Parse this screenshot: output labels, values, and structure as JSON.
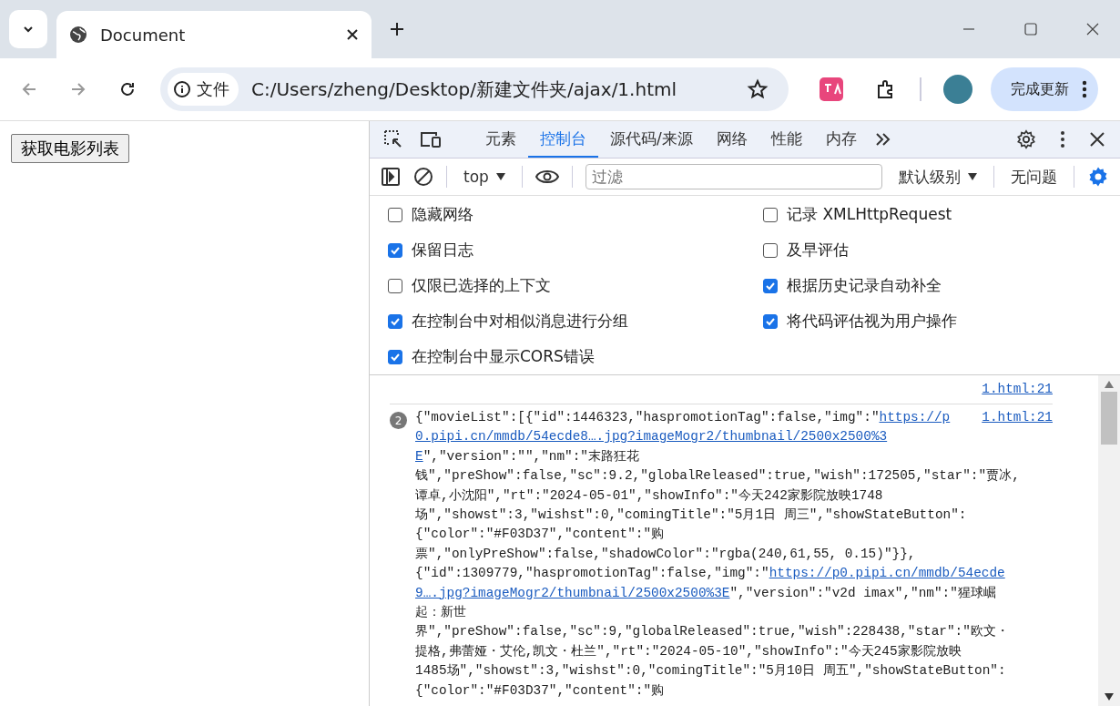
{
  "browser": {
    "tab_title": "Document",
    "address": {
      "badge": "文件",
      "url": "C:/Users/zheng/Desktop/新建文件夹/ajax/1.html"
    },
    "update_button": "完成更新"
  },
  "page": {
    "button": "获取电影列表"
  },
  "devtools": {
    "tabs": [
      {
        "label": "元素",
        "selected": false
      },
      {
        "label": "控制台",
        "selected": true
      },
      {
        "label": "源代码/来源",
        "selected": false
      },
      {
        "label": "网络",
        "selected": false
      },
      {
        "label": "性能",
        "selected": false
      },
      {
        "label": "内存",
        "selected": false
      }
    ],
    "toolbar": {
      "context": "top",
      "filter_placeholder": "过滤",
      "levels": "默认级别",
      "issues": "无问题"
    },
    "settings": [
      {
        "label": "隐藏网络",
        "checked": false
      },
      {
        "label": "记录 XMLHttpRequest",
        "checked": false
      },
      {
        "label": "保留日志",
        "checked": true
      },
      {
        "label": "及早评估",
        "checked": false
      },
      {
        "label": "仅限已选择的上下文",
        "checked": false
      },
      {
        "label": "根据历史记录自动补全",
        "checked": true
      },
      {
        "label": "在控制台中对相似消息进行分组",
        "checked": true
      },
      {
        "label": "将代码评估视为用户操作",
        "checked": true
      },
      {
        "label": "在控制台中显示CORS错误",
        "checked": true
      }
    ],
    "messages": [
      {
        "source": "1.html:21"
      },
      {
        "count": "2",
        "source": "1.html:21",
        "lines": [
          [
            {
              "kind": "text",
              "text": "{\"movieList\":[{\"id\":1446323,\"haspromotionTag\":false,\"img\":\""
            },
            {
              "kind": "link",
              "text": "https://p"
            }
          ],
          [
            {
              "kind": "link",
              "text": "0.pipi.cn/mmdb/54ecde8….jpg?imageMogr2/thumbnail/2500x2500%3"
            }
          ],
          [
            {
              "kind": "link",
              "text": "E"
            },
            {
              "kind": "text",
              "text": "\",\"version\":\"\",\"nm\":\"末路狂花"
            }
          ],
          [
            {
              "kind": "text",
              "text": "钱\",\"preShow\":false,\"sc\":9.2,\"globalReleased\":true,\"wish\":172505,\"star\":\"贾冰,"
            }
          ],
          [
            {
              "kind": "text",
              "text": "谭卓,小沈阳\",\"rt\":\"2024-05-01\",\"showInfo\":\"今天242家影院放映1748"
            }
          ],
          [
            {
              "kind": "text",
              "text": "场\",\"showst\":3,\"wishst\":0,\"comingTitle\":\"5月1日 周三\",\"showStateButton\":"
            }
          ],
          [
            {
              "kind": "text",
              "text": "{\"color\":\"#F03D37\",\"content\":\"购"
            }
          ],
          [
            {
              "kind": "text",
              "text": "票\",\"onlyPreShow\":false,\"shadowColor\":\"rgba(240,61,55, 0.15)\"}},"
            }
          ],
          [
            {
              "kind": "text",
              "text": "{\"id\":1309779,\"haspromotionTag\":false,\"img\":\""
            },
            {
              "kind": "link",
              "text": "https://p0.pipi.cn/mmdb/54ecde"
            }
          ],
          [
            {
              "kind": "link",
              "text": "9….jpg?imageMogr2/thumbnail/2500x2500%3E"
            },
            {
              "kind": "text",
              "text": "\",\"version\":\"v2d imax\",\"nm\":\"猩球崛"
            }
          ],
          [
            {
              "kind": "text",
              "text": "起：新世"
            }
          ],
          [
            {
              "kind": "text",
              "text": "界\",\"preShow\":false,\"sc\":9,\"globalReleased\":true,\"wish\":228438,\"star\":\"欧文・"
            }
          ],
          [
            {
              "kind": "text",
              "text": "提格,弗蕾娅・艾伦,凯文・杜兰\",\"rt\":\"2024-05-10\",\"showInfo\":\"今天245家影院放映"
            }
          ],
          [
            {
              "kind": "text",
              "text": "1485场\",\"showst\":3,\"wishst\":0,\"comingTitle\":\"5月10日 周五\",\"showStateButton\":"
            }
          ],
          [
            {
              "kind": "text",
              "text": "{\"color\":\"#F03D37\",\"content\":\"购"
            }
          ]
        ]
      }
    ]
  }
}
